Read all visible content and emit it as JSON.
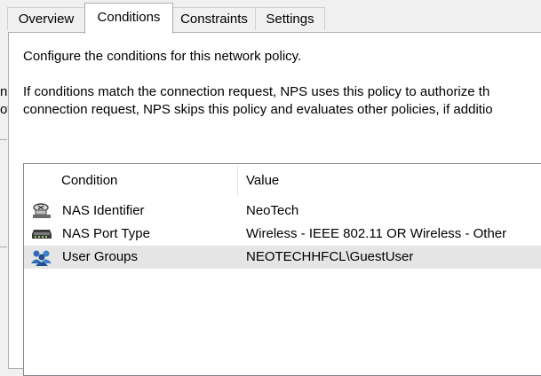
{
  "tabs": [
    {
      "label": "Overview"
    },
    {
      "label": "Conditions"
    },
    {
      "label": "Constraints"
    },
    {
      "label": "Settings"
    }
  ],
  "content": {
    "intro": "Configure the conditions for this network policy.",
    "description_line1": "If conditions match the connection request, NPS uses this policy to authorize th",
    "description_line2": "connection request, NPS skips this policy and evaluates other policies, if additio"
  },
  "left_stub": {
    "char1": "n",
    "char2": "ot"
  },
  "conditions_table": {
    "columns": [
      "Condition",
      "Value"
    ],
    "rows": [
      {
        "icon": "nas-identifier-icon",
        "condition": "NAS Identifier",
        "value": "NeoTech"
      },
      {
        "icon": "nas-port-type-icon",
        "condition": "NAS Port Type",
        "value": "Wireless - IEEE 802.11 OR Wireless - Other"
      },
      {
        "icon": "user-groups-icon",
        "condition": "User Groups",
        "value": "NEOTECHHFCL\\GuestUser"
      }
    ]
  }
}
